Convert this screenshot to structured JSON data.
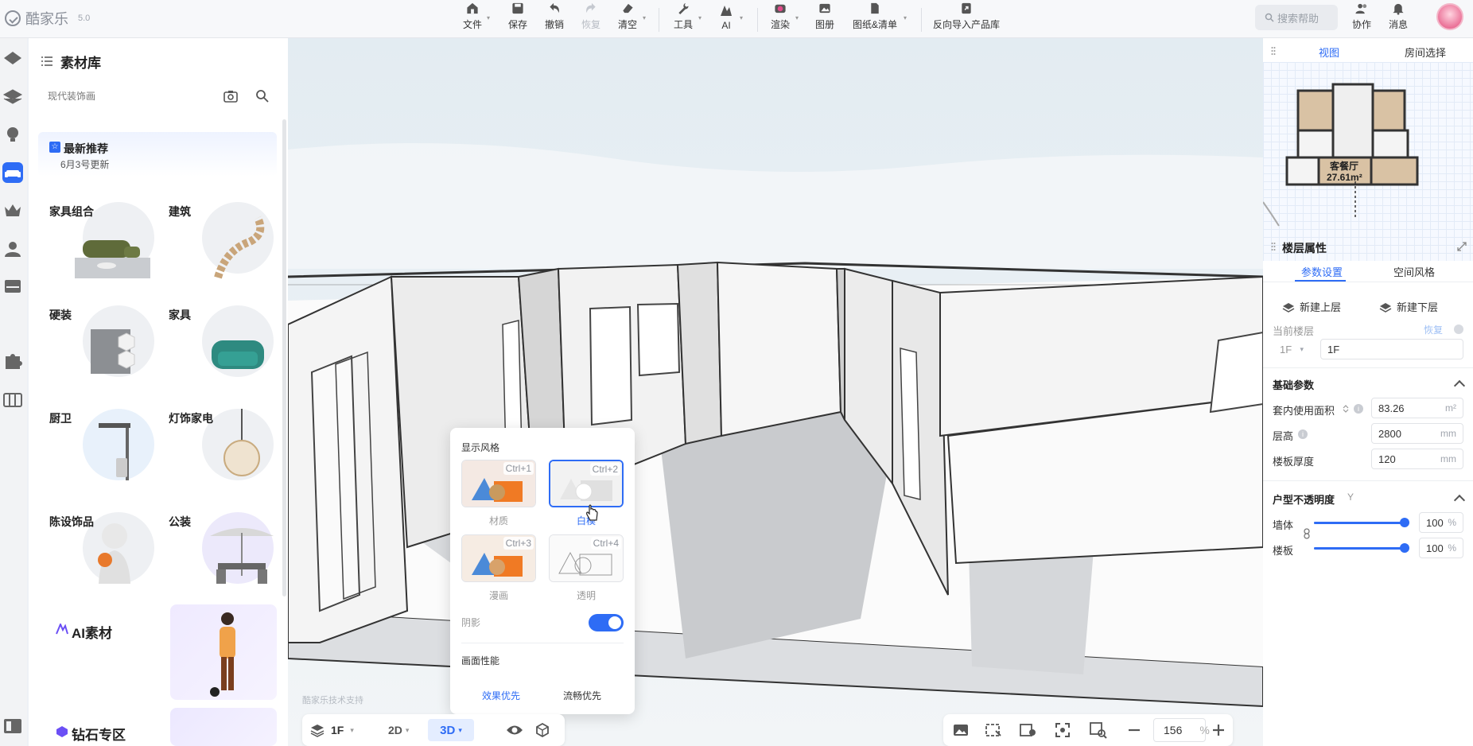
{
  "app": {
    "name": "酷家乐",
    "version": "5.0"
  },
  "toolbar": {
    "file": "文件",
    "save": "保存",
    "undo": "撤销",
    "redo": "恢复",
    "clear": "清空",
    "tools": "工具",
    "ai": "AI",
    "render": "渲染",
    "album": "图册",
    "drawings": "图纸&清单",
    "reverse_import": "反向导入产品库"
  },
  "header_right": {
    "help_placeholder": "搜索帮助",
    "collab": "协作",
    "messages": "消息"
  },
  "material_panel": {
    "title": "素材库",
    "search_placeholder": "现代装饰画",
    "recommend": {
      "title": "最新推荐",
      "subtitle": "6月3号更新"
    },
    "categories": [
      "家具组合",
      "建筑",
      "硬装",
      "家具",
      "厨卫",
      "灯饰家电",
      "陈设饰品",
      "公装"
    ],
    "ai_title": "AI素材",
    "diamond_title": "钻石专区"
  },
  "viewport": {
    "watermark": "酷家乐技术支持"
  },
  "display_popup": {
    "title": "显示风格",
    "tiles": [
      {
        "name": "材质",
        "shortcut": "Ctrl+1"
      },
      {
        "name": "白模",
        "shortcut": "Ctrl+2"
      },
      {
        "name": "漫画",
        "shortcut": "Ctrl+3"
      },
      {
        "name": "透明",
        "shortcut": "Ctrl+4"
      }
    ],
    "selected": "白模",
    "shadow_label": "阴影",
    "shadow_on": true,
    "perf_title": "画面性能",
    "perf_quality": "效果优先",
    "perf_smooth": "流畅优先"
  },
  "bottom_bar": {
    "floor": "1F",
    "mode_2d": "2D",
    "mode_3d": "3D",
    "zoom": "156",
    "zoom_unit": "%"
  },
  "right_panel": {
    "tab_view": "视图",
    "tab_room": "房间选择",
    "minimap_label": "客餐厅",
    "minimap_area": "27.61m²",
    "floor_props_title": "楼层属性",
    "subtab_params": "参数设置",
    "subtab_style": "空间风格",
    "new_upper": "新建上层",
    "new_lower": "新建下层",
    "current_floor_label": "当前楼层",
    "restore": "恢复",
    "floor_select": "1F",
    "floor_name": "1F",
    "basic_params": "基础参数",
    "inner_area_label": "套内使用面积",
    "inner_area": "83.26",
    "inner_area_unit": "m²",
    "height_label": "层高",
    "height": "2800",
    "height_unit": "mm",
    "slab_label": "楼板厚度",
    "slab": "120",
    "slab_unit": "mm",
    "opacity_title": "户型不透明度",
    "opacity_key": "Y",
    "wall_label": "墙体",
    "wall_value": "100",
    "wall_unit": "%",
    "floor_label": "楼板",
    "floor_value": "100",
    "floor_unit": "%"
  },
  "colors": {
    "accent": "#2e6cf5"
  }
}
